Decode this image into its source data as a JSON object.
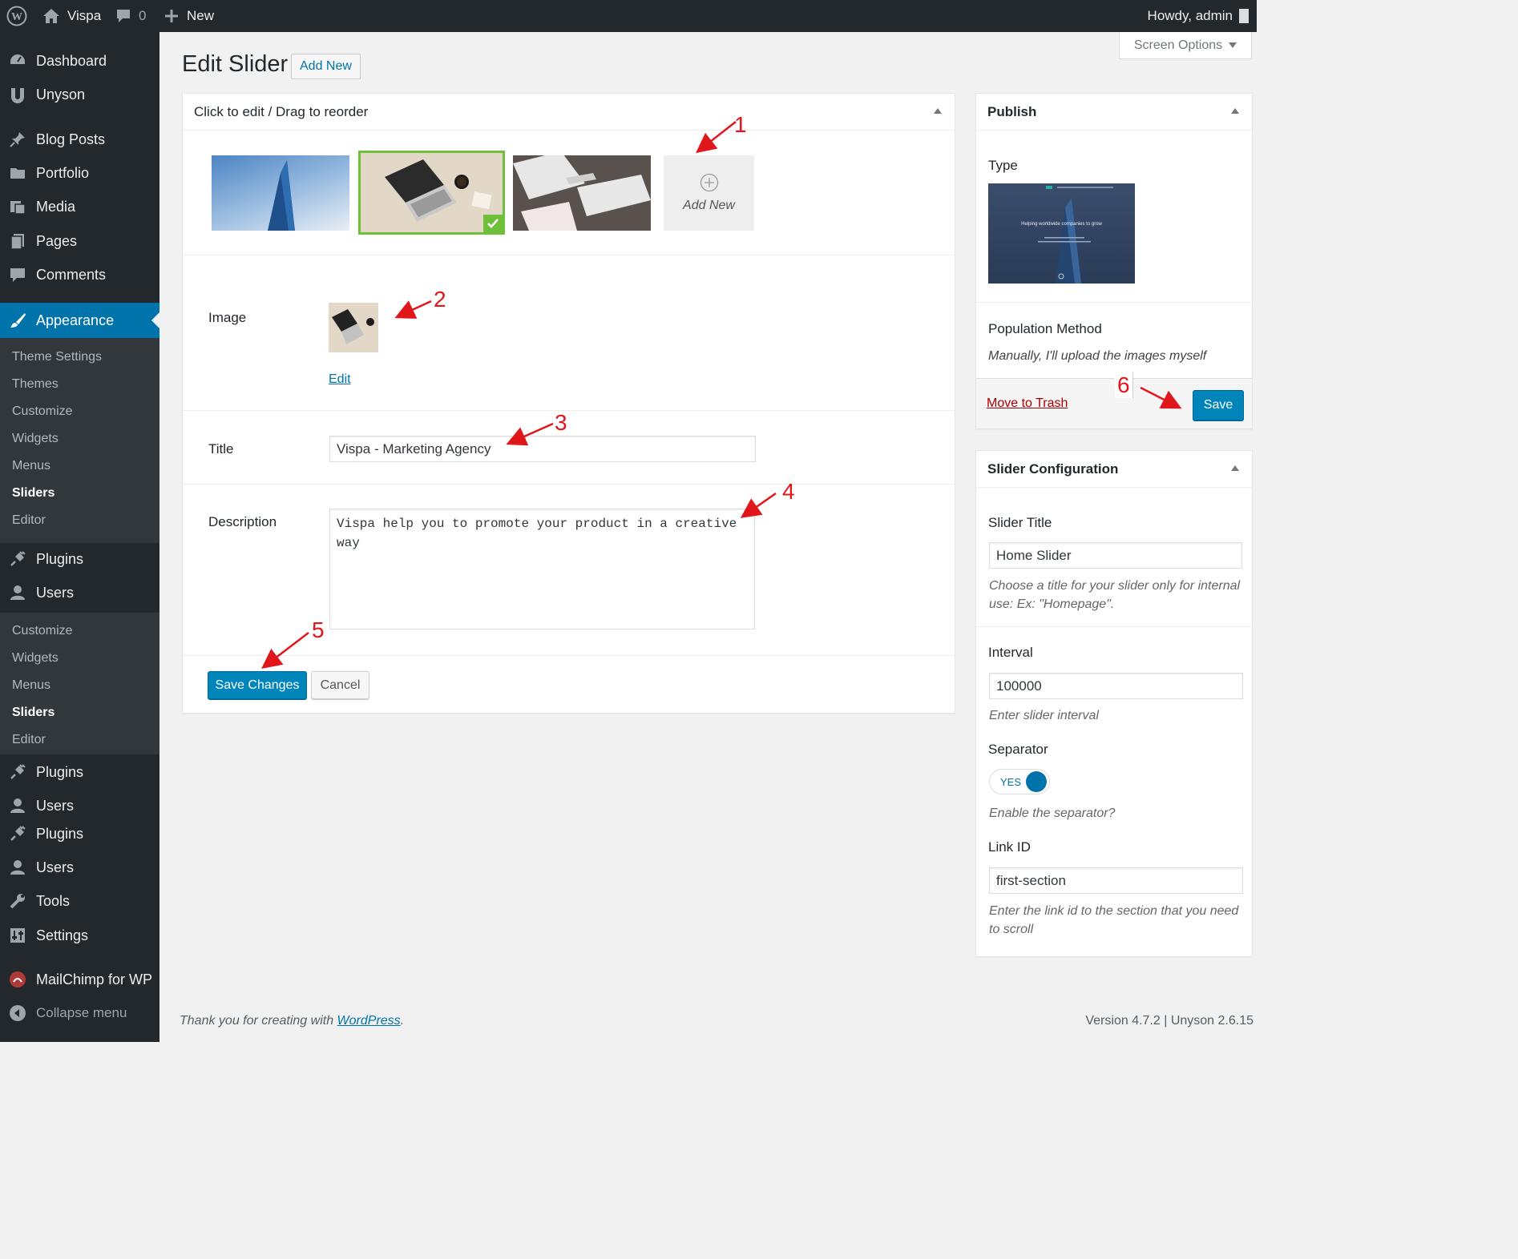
{
  "adminbar": {
    "site_name": "Vispa",
    "comments_count": "0",
    "new_label": "New",
    "howdy": "Howdy, admin"
  },
  "sidebar": {
    "items_top": [
      {
        "label": "Dashboard",
        "icon": "dashboard-icon"
      },
      {
        "label": "Unyson",
        "icon": "unyson-icon"
      },
      {
        "label": "Blog Posts",
        "icon": "pin-icon"
      },
      {
        "label": "Portfolio",
        "icon": "folder-icon"
      },
      {
        "label": "Media",
        "icon": "media-icon"
      },
      {
        "label": "Pages",
        "icon": "pages-icon"
      },
      {
        "label": "Comments",
        "icon": "comment-icon"
      },
      {
        "label": "Appearance",
        "icon": "brush-icon"
      }
    ],
    "appearance_sub": [
      "Theme Settings",
      "Themes",
      "Customize",
      "Widgets",
      "Menus",
      "Sliders",
      "Editor"
    ],
    "items_mid": [
      {
        "label": "Plugins",
        "icon": "plugin-icon"
      },
      {
        "label": "Users",
        "icon": "user-icon"
      }
    ],
    "sub2": [
      "Customize",
      "Widgets",
      "Menus",
      "Sliders",
      "Editor"
    ],
    "items_bottom": [
      {
        "label": "Plugins",
        "icon": "plugin-icon"
      },
      {
        "label": "Users",
        "icon": "user-icon"
      },
      {
        "label": "Plugins",
        "icon": "plugin-icon"
      },
      {
        "label": "Users",
        "icon": "user-icon"
      },
      {
        "label": "Tools",
        "icon": "wrench-icon"
      },
      {
        "label": "Settings",
        "icon": "settings-icon"
      },
      {
        "label": "MailChimp for WP",
        "icon": "mailchimp-icon"
      },
      {
        "label": "Collapse menu",
        "icon": "collapse-icon"
      }
    ]
  },
  "header": {
    "title": "Edit Slider",
    "add_new": "Add New",
    "screen_options": "Screen Options"
  },
  "slides_box": {
    "title": "Click to edit / Drag to reorder",
    "add_new": "Add New",
    "image_label": "Image",
    "edit_link": "Edit",
    "title_label": "Title",
    "title_value": "Vispa - Marketing Agency",
    "description_label": "Description",
    "description_value": "Vispa help you to promote your product in a creative way",
    "save_changes": "Save Changes",
    "cancel": "Cancel"
  },
  "publish": {
    "title": "Publish",
    "type_label": "Type",
    "preview_caption": "Helping worldwide companies to grow",
    "population_label": "Population Method",
    "population_value": "Manually, I'll upload the images myself",
    "trash": "Move to Trash",
    "save": "Save"
  },
  "slider_config": {
    "title": "Slider Configuration",
    "slider_title_label": "Slider Title",
    "slider_title_value": "Home Slider",
    "slider_title_help": "Choose a title for your slider only for internal use: Ex: \"Homepage\".",
    "interval_label": "Interval",
    "interval_value": "100000",
    "interval_help": "Enter slider interval",
    "separator_label": "Separator",
    "separator_toggle": "YES",
    "separator_help": "Enable the separator?",
    "link_id_label": "Link ID",
    "link_id_value": "first-section",
    "link_id_help": "Enter the link id to the section that you need to scroll"
  },
  "annotations": [
    "1",
    "2",
    "3",
    "4",
    "5",
    "6"
  ],
  "footer": {
    "thanks_prefix": "Thank you for creating with",
    "wordpress": "WordPress",
    "thanks_suffix": ".",
    "version": "Version 4.7.2 | Unyson 2.6.15"
  },
  "colors": {
    "accent": "#0073aa",
    "primary_button": "#0085ba",
    "sidebar_bg": "#23282d",
    "selected_border": "#6fbf3a",
    "annotation": "#e0161b"
  }
}
